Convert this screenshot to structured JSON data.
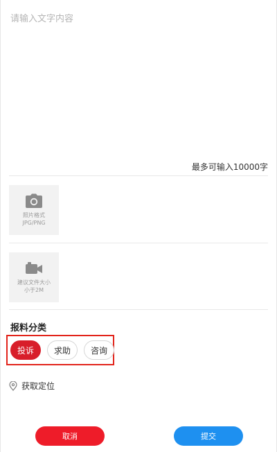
{
  "compose": {
    "placeholder": "请输入文字内容",
    "value": "",
    "char_limit_text": "最多可输入10000字"
  },
  "uploads": {
    "photo": {
      "icon": "camera-icon",
      "line1": "照片格式",
      "line2": "JPG/PNG"
    },
    "video": {
      "icon": "video-camera-icon",
      "line1": "建议文件大小",
      "line2": "小于2M"
    }
  },
  "category": {
    "title": "报料分类",
    "options": [
      {
        "label": "投诉",
        "selected": true
      },
      {
        "label": "求助",
        "selected": false
      },
      {
        "label": "咨询",
        "selected": false
      }
    ],
    "accent_color": "#d81e2a"
  },
  "location": {
    "icon": "location-pin-icon",
    "label": "获取定位"
  },
  "actions": {
    "cancel_label": "取消",
    "submit_label": "提交",
    "cancel_color": "#ee1c29",
    "submit_color": "#1e90f0"
  }
}
